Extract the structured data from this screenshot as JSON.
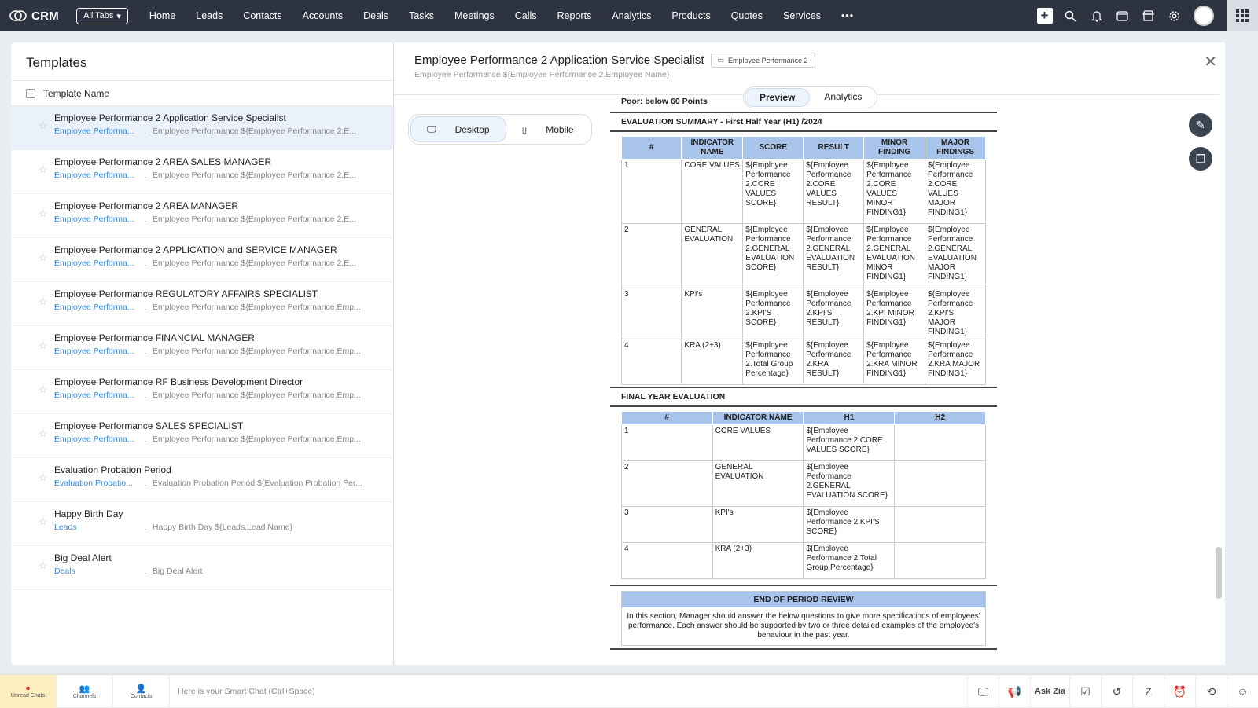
{
  "app": {
    "name": "CRM",
    "all_tabs": "All Tabs"
  },
  "nav": [
    "Home",
    "Leads",
    "Contacts",
    "Accounts",
    "Deals",
    "Tasks",
    "Meetings",
    "Calls",
    "Reports",
    "Analytics",
    "Products",
    "Quotes",
    "Services"
  ],
  "left": {
    "title": "Templates",
    "column": "Template Name",
    "rows": [
      {
        "name": "Employee Performance 2 Application Service Specialist",
        "module": "Employee Performa...",
        "subject": "Employee Performance ${Employee Performance 2.E...",
        "selected": true
      },
      {
        "name": "Employee Performance 2 AREA SALES MANAGER",
        "module": "Employee Performa...",
        "subject": "Employee Performance ${Employee Performance 2.E..."
      },
      {
        "name": "Employee Performance 2 AREA MANAGER",
        "module": "Employee Performa...",
        "subject": "Employee Performance ${Employee Performance 2.E..."
      },
      {
        "name": "Employee Performance 2 APPLICATION and SERVICE MANAGER",
        "module": "Employee Performa...",
        "subject": "Employee Performance ${Employee Performance 2.E..."
      },
      {
        "name": "Employee Performance REGULATORY AFFAIRS SPECIALIST",
        "module": "Employee Performa...",
        "subject": "Employee Performance ${Employee Performance.Emp..."
      },
      {
        "name": "Employee Performance FINANCIAL MANAGER",
        "module": "Employee Performa...",
        "subject": "Employee Performance ${Employee Performance.Emp..."
      },
      {
        "name": "Employee Performance RF Business Development Director",
        "module": "Employee Performa...",
        "subject": "Employee Performance ${Employee Performance.Emp..."
      },
      {
        "name": "Employee Performance SALES SPECIALIST",
        "module": "Employee Performa...",
        "subject": "Employee Performance ${Employee Performance.Emp..."
      },
      {
        "name": "Evaluation Probation Period",
        "module": "Evaluation Probatio...",
        "subject": "Evaluation Probation Period ${Evaluation Probation Per..."
      },
      {
        "name": "Happy Birth Day",
        "module": "Leads",
        "subject": "Happy Birth Day ${Leads.Lead Name}"
      },
      {
        "name": "Big Deal Alert",
        "module": "Deals",
        "subject": "Big Deal Alert"
      }
    ]
  },
  "detail": {
    "title": "Employee Performance 2 Application Service Specialist",
    "tag": "Employee Performance 2",
    "subject": "Employee Performance ${Employee Performance 2.Employee Name}",
    "tab_preview": "Preview",
    "tab_analytics": "Analytics",
    "desktop": "Desktop",
    "mobile": "Mobile"
  },
  "doc": {
    "poor": "Poor: below 60 Points",
    "eval_summary": "EVALUATION SUMMARY - First Half Year (H1) /2024",
    "summary_headers": [
      "#",
      "INDICATOR NAME",
      "SCORE",
      "RESULT",
      "MINOR FINDING",
      "MAJOR FINDINGS"
    ],
    "summary_rows": [
      [
        "1",
        "CORE VALUES",
        "${Employee Performance 2.CORE VALUES SCORE}",
        "${Employee Performance 2.CORE VALUES RESULT}",
        "${Employee Performance 2.CORE VALUES MINOR FINDING1}",
        "${Employee Performance 2.CORE VALUES MAJOR FINDING1}"
      ],
      [
        "2",
        "GENERAL EVALUATION",
        "${Employee Performance 2.GENERAL EVALUATION SCORE}",
        "${Employee Performance 2.GENERAL EVALUATION RESULT}",
        "${Employee Performance 2.GENERAL EVALUATION MINOR FINDING1}",
        "${Employee Performance 2.GENERAL EVALUATION MAJOR FINDING1}"
      ],
      [
        "3",
        "KPI's",
        "${Employee Performance 2.KPI'S SCORE}",
        "${Employee Performance 2.KPI'S RESULT}",
        "${Employee Performance 2.KPI MINOR FINDING1}",
        "${Employee Performance 2.KPI'S MAJOR FINDING1}"
      ],
      [
        "4",
        "KRA (2+3)",
        "${Employee Performance 2.Total Group Percentage}",
        "${Employee Performance 2.KRA RESULT}",
        "${Employee Performance 2.KRA MINOR FINDING1}",
        "${Employee Performance 2.KRA MAJOR FINDING1}"
      ]
    ],
    "final_title": "FINAL YEAR EVALUATION",
    "final_headers": [
      "#",
      "INDICATOR NAME",
      "H1",
      "H2"
    ],
    "final_rows": [
      [
        "1",
        "CORE VALUES",
        "${Employee Performance 2.CORE VALUES SCORE}",
        ""
      ],
      [
        "2",
        "GENERAL EVALUATION",
        "${Employee Performance 2.GENERAL EVALUATION SCORE}",
        ""
      ],
      [
        "3",
        "KPI's",
        "${Employee Performance 2.KPI'S SCORE}",
        ""
      ],
      [
        "4",
        "KRA (2+3)",
        "${Employee Performance 2.Total Group Percentage}",
        ""
      ]
    ],
    "end_title": "END OF PERIOD REVIEW",
    "end_text": "In this section, Manager should answer the below questions to give more specifications of employees' performance. Each answer should be supported by two or three detailed examples of the employee's behaviour in the past year."
  },
  "bottom": {
    "unread": "Unread Chats",
    "channels": "Channels",
    "contacts": "Contacts",
    "smartchat": "Here is your Smart Chat (Ctrl+Space)",
    "askzia": "Ask Zia"
  }
}
